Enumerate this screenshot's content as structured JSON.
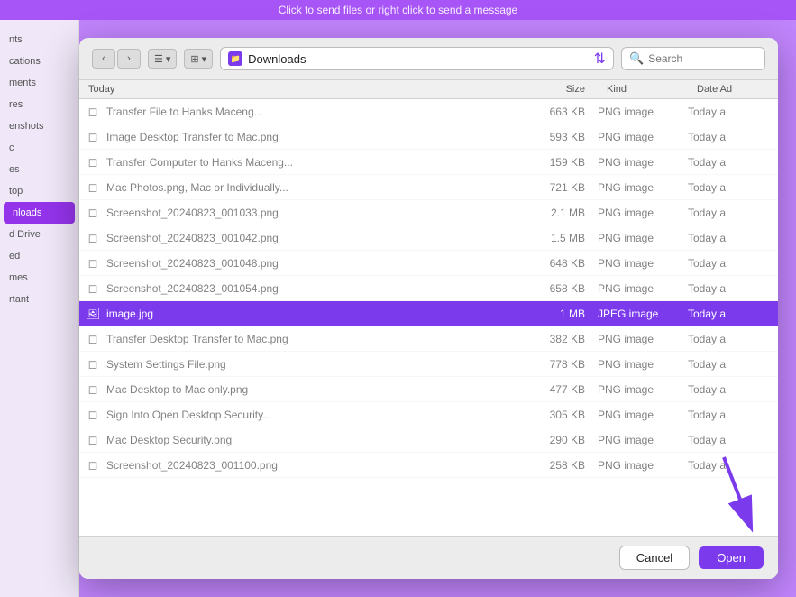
{
  "topbar": {
    "text": "Click to send files or right click to send a message"
  },
  "toolbar": {
    "back_label": "‹",
    "forward_label": "›",
    "list_view_label": "☰",
    "grid_view_label": "⊞",
    "chevron_down": "▾",
    "location": "Downloads",
    "search_placeholder": "Search"
  },
  "columns": {
    "name": "Today",
    "size": "Size",
    "kind": "Kind",
    "date": "Date Ad"
  },
  "sidebar": {
    "items": [
      {
        "label": "nts",
        "active": false
      },
      {
        "label": "cations",
        "active": false
      },
      {
        "label": "ments",
        "active": false
      },
      {
        "label": "res",
        "active": false
      },
      {
        "label": "enshots",
        "active": false
      },
      {
        "label": "c",
        "active": false
      },
      {
        "label": "es",
        "active": false
      },
      {
        "label": "top",
        "active": false
      },
      {
        "label": "nloads",
        "active": true
      },
      {
        "label": "d Drive",
        "active": false
      },
      {
        "label": "ed",
        "active": false
      },
      {
        "label": "mes",
        "active": false
      },
      {
        "label": "rtant",
        "active": false
      }
    ]
  },
  "files": [
    {
      "icon": "🖼",
      "name": "Transfer File to Hanks Maceng...",
      "size": "663 KB",
      "kind": "PNG image",
      "date": "Today a",
      "blurred": true,
      "selected": false
    },
    {
      "icon": "🖼",
      "name": "Image Desktop Transfer to Mac.png",
      "size": "593 KB",
      "kind": "PNG image",
      "date": "Today a",
      "blurred": true,
      "selected": false
    },
    {
      "icon": "🖼",
      "name": "Transfer Computer to Hanks Maceng...",
      "size": "159 KB",
      "kind": "PNG image",
      "date": "Today a",
      "blurred": true,
      "selected": false
    },
    {
      "icon": "🖼",
      "name": "Mac Photos.png, Mac or Individually...",
      "size": "721 KB",
      "kind": "PNG image",
      "date": "Today a",
      "blurred": true,
      "selected": false
    },
    {
      "icon": "🖼",
      "name": "Screenshot_20240823_001033.png",
      "size": "2.1 MB",
      "kind": "PNG image",
      "date": "Today a",
      "blurred": true,
      "selected": false
    },
    {
      "icon": "🖼",
      "name": "Screenshot_20240823_001042.png",
      "size": "1.5 MB",
      "kind": "PNG image",
      "date": "Today a",
      "blurred": true,
      "selected": false
    },
    {
      "icon": "🖼",
      "name": "Screenshot_20240823_001048.png",
      "size": "648 KB",
      "kind": "PNG image",
      "date": "Today a",
      "blurred": true,
      "selected": false
    },
    {
      "icon": "🖼",
      "name": "Screenshot_20240823_001054.png",
      "size": "658 KB",
      "kind": "PNG image",
      "date": "Today a",
      "blurred": true,
      "selected": false
    },
    {
      "icon": "🖼",
      "name": "image.jpg",
      "size": "1 MB",
      "kind": "JPEG image",
      "date": "Today a",
      "blurred": false,
      "selected": true
    },
    {
      "icon": "🖼",
      "name": "Transfer Desktop Transfer to Mac.png",
      "size": "382 KB",
      "kind": "PNG image",
      "date": "Today a",
      "blurred": true,
      "selected": false
    },
    {
      "icon": "🖼",
      "name": "System Settings File.png",
      "size": "778 KB",
      "kind": "PNG image",
      "date": "Today a",
      "blurred": true,
      "selected": false
    },
    {
      "icon": "🖼",
      "name": "Mac Desktop to Mac only.png",
      "size": "477 KB",
      "kind": "PNG image",
      "date": "Today a",
      "blurred": true,
      "selected": false
    },
    {
      "icon": "🖼",
      "name": "Sign Into Open Desktop Security...",
      "size": "305 KB",
      "kind": "PNG image",
      "date": "Today a",
      "blurred": true,
      "selected": false
    },
    {
      "icon": "🖼",
      "name": "Mac Desktop Security.png",
      "size": "290 KB",
      "kind": "PNG image",
      "date": "Today a",
      "blurred": true,
      "selected": false
    },
    {
      "icon": "🖼",
      "name": "Screenshot_20240823_001100.png",
      "size": "258 KB",
      "kind": "PNG image",
      "date": "Today a",
      "blurred": true,
      "selected": false
    }
  ],
  "footer": {
    "cancel_label": "Cancel",
    "open_label": "Open"
  }
}
